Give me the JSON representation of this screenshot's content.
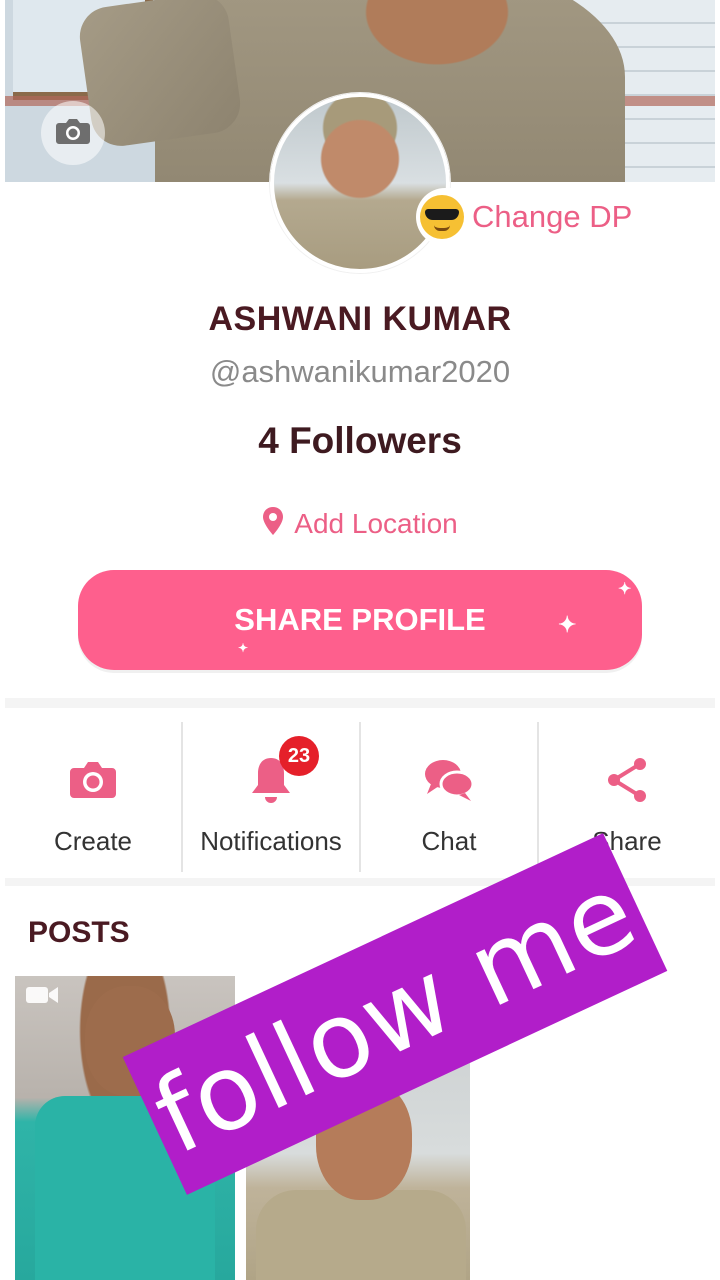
{
  "profile": {
    "name": "ASHWANI KUMAR",
    "handle": "@ashwanikumar2020",
    "followers": "4 Followers",
    "change_dp_label": "Change DP",
    "location_label": "Add Location",
    "share_label": "SHARE PROFILE"
  },
  "actions": [
    {
      "label": "Create",
      "icon": "camera-icon"
    },
    {
      "label": "Notifications",
      "icon": "bell-icon",
      "badge": "23"
    },
    {
      "label": "Chat",
      "icon": "chat-bubbles-icon"
    },
    {
      "label": "Share",
      "icon": "share-icon"
    }
  ],
  "posts": {
    "heading": "POSTS"
  },
  "overlay": {
    "sticker_text": "follow me"
  },
  "colors": {
    "accent": "#fe5f8d",
    "accent_text": "#ec5f86",
    "badge": "#e5202a",
    "sticker": "#b11ec9",
    "name_text": "#4a1a22"
  }
}
